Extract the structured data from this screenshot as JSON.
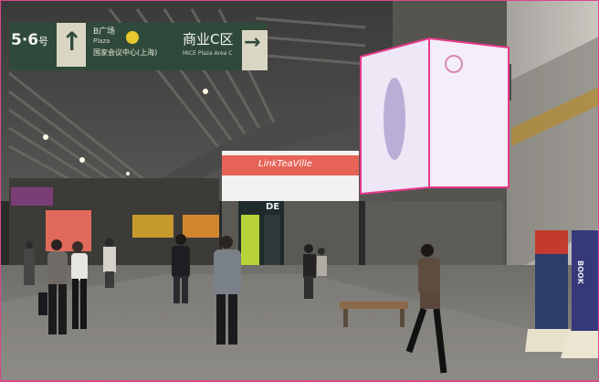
{
  "sign": {
    "floors": "5·6",
    "floors_suffix": "号",
    "up_arrow": "↑",
    "plaza_line1": "B广场",
    "plaza_line2": "Plaza",
    "plaza_line3": "国家会议中心(上海)",
    "zone": "商业C区",
    "zone_sub": "MICE Plaza Area C",
    "right_arrow": "→"
  },
  "storefront": {
    "banner_text": "LinkTeaVille"
  },
  "kiosk": {
    "label_top": "DE"
  },
  "rollup_banners": {
    "right_label": "BOOK"
  },
  "colors": {
    "sign_green": "#2f4a3a",
    "sign_light": "#d9d7c4",
    "lightbox_pink": "#e63a8a",
    "lightbox_face": "#ece6f4",
    "frame": "#d9478a"
  }
}
